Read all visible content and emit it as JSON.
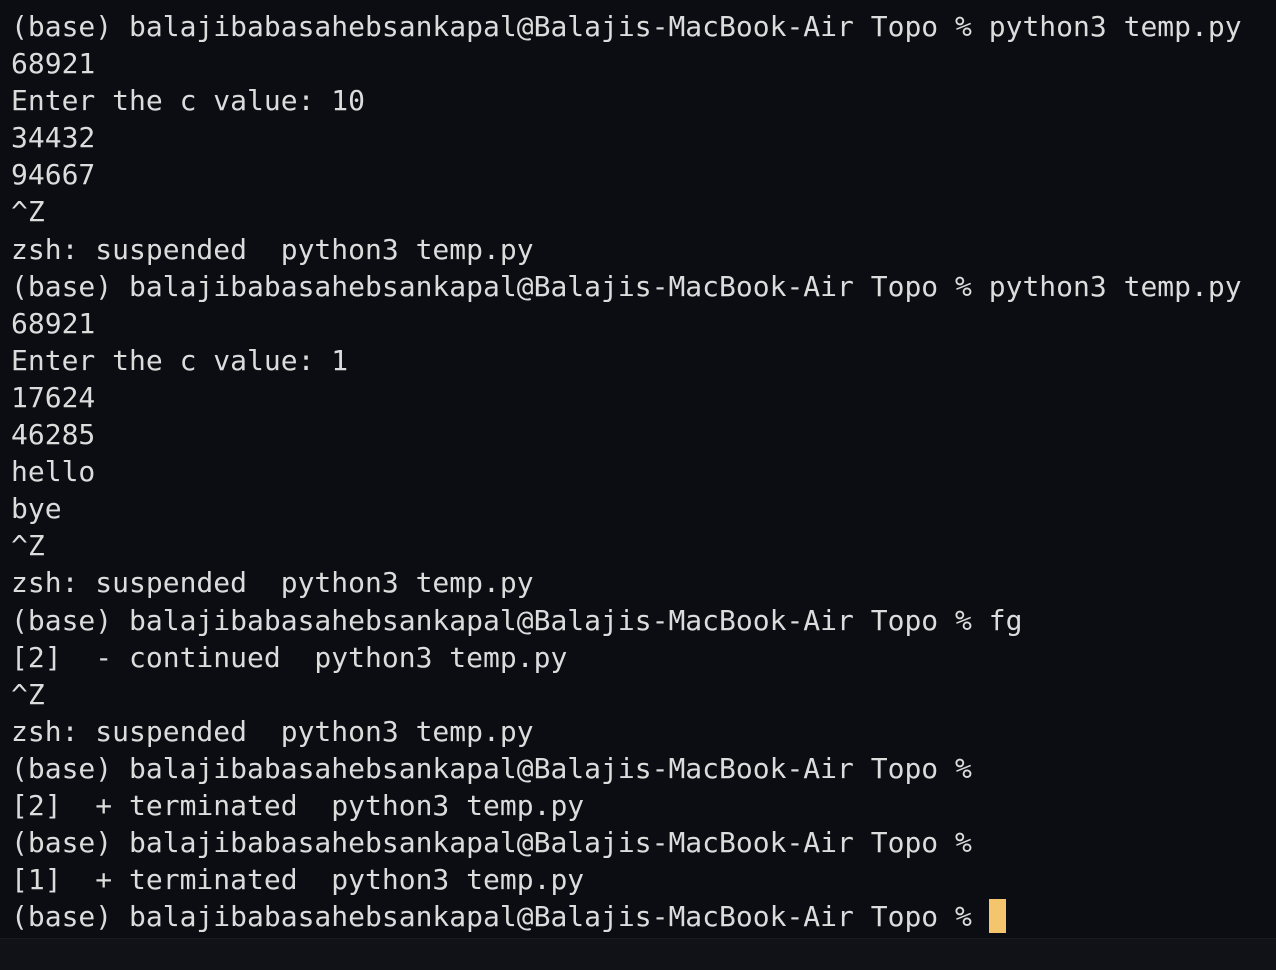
{
  "terminal": {
    "lines": [
      "(base) balajibabasahebsankapal@Balajis-MacBook-Air Topo % python3 temp.py",
      "68921",
      "Enter the c value: 10",
      "34432",
      "94667",
      "^Z",
      "zsh: suspended  python3 temp.py",
      "(base) balajibabasahebsankapal@Balajis-MacBook-Air Topo % python3 temp.py",
      "68921",
      "Enter the c value: 1",
      "17624",
      "46285",
      "hello",
      "bye",
      "^Z",
      "zsh: suspended  python3 temp.py",
      "(base) balajibabasahebsankapal@Balajis-MacBook-Air Topo % fg",
      "[2]  - continued  python3 temp.py",
      "^Z",
      "zsh: suspended  python3 temp.py",
      "(base) balajibabasahebsankapal@Balajis-MacBook-Air Topo %",
      "[2]  + terminated  python3 temp.py",
      "(base) balajibabasahebsankapal@Balajis-MacBook-Air Topo %",
      "[1]  + terminated  python3 temp.py"
    ],
    "current_prompt": "(base) balajibabasahebsankapal@Balajis-MacBook-Air Topo % ",
    "colors": {
      "background": "#0b0d12",
      "text": "#dcdcdc",
      "cursor": "#f5c56d"
    }
  }
}
